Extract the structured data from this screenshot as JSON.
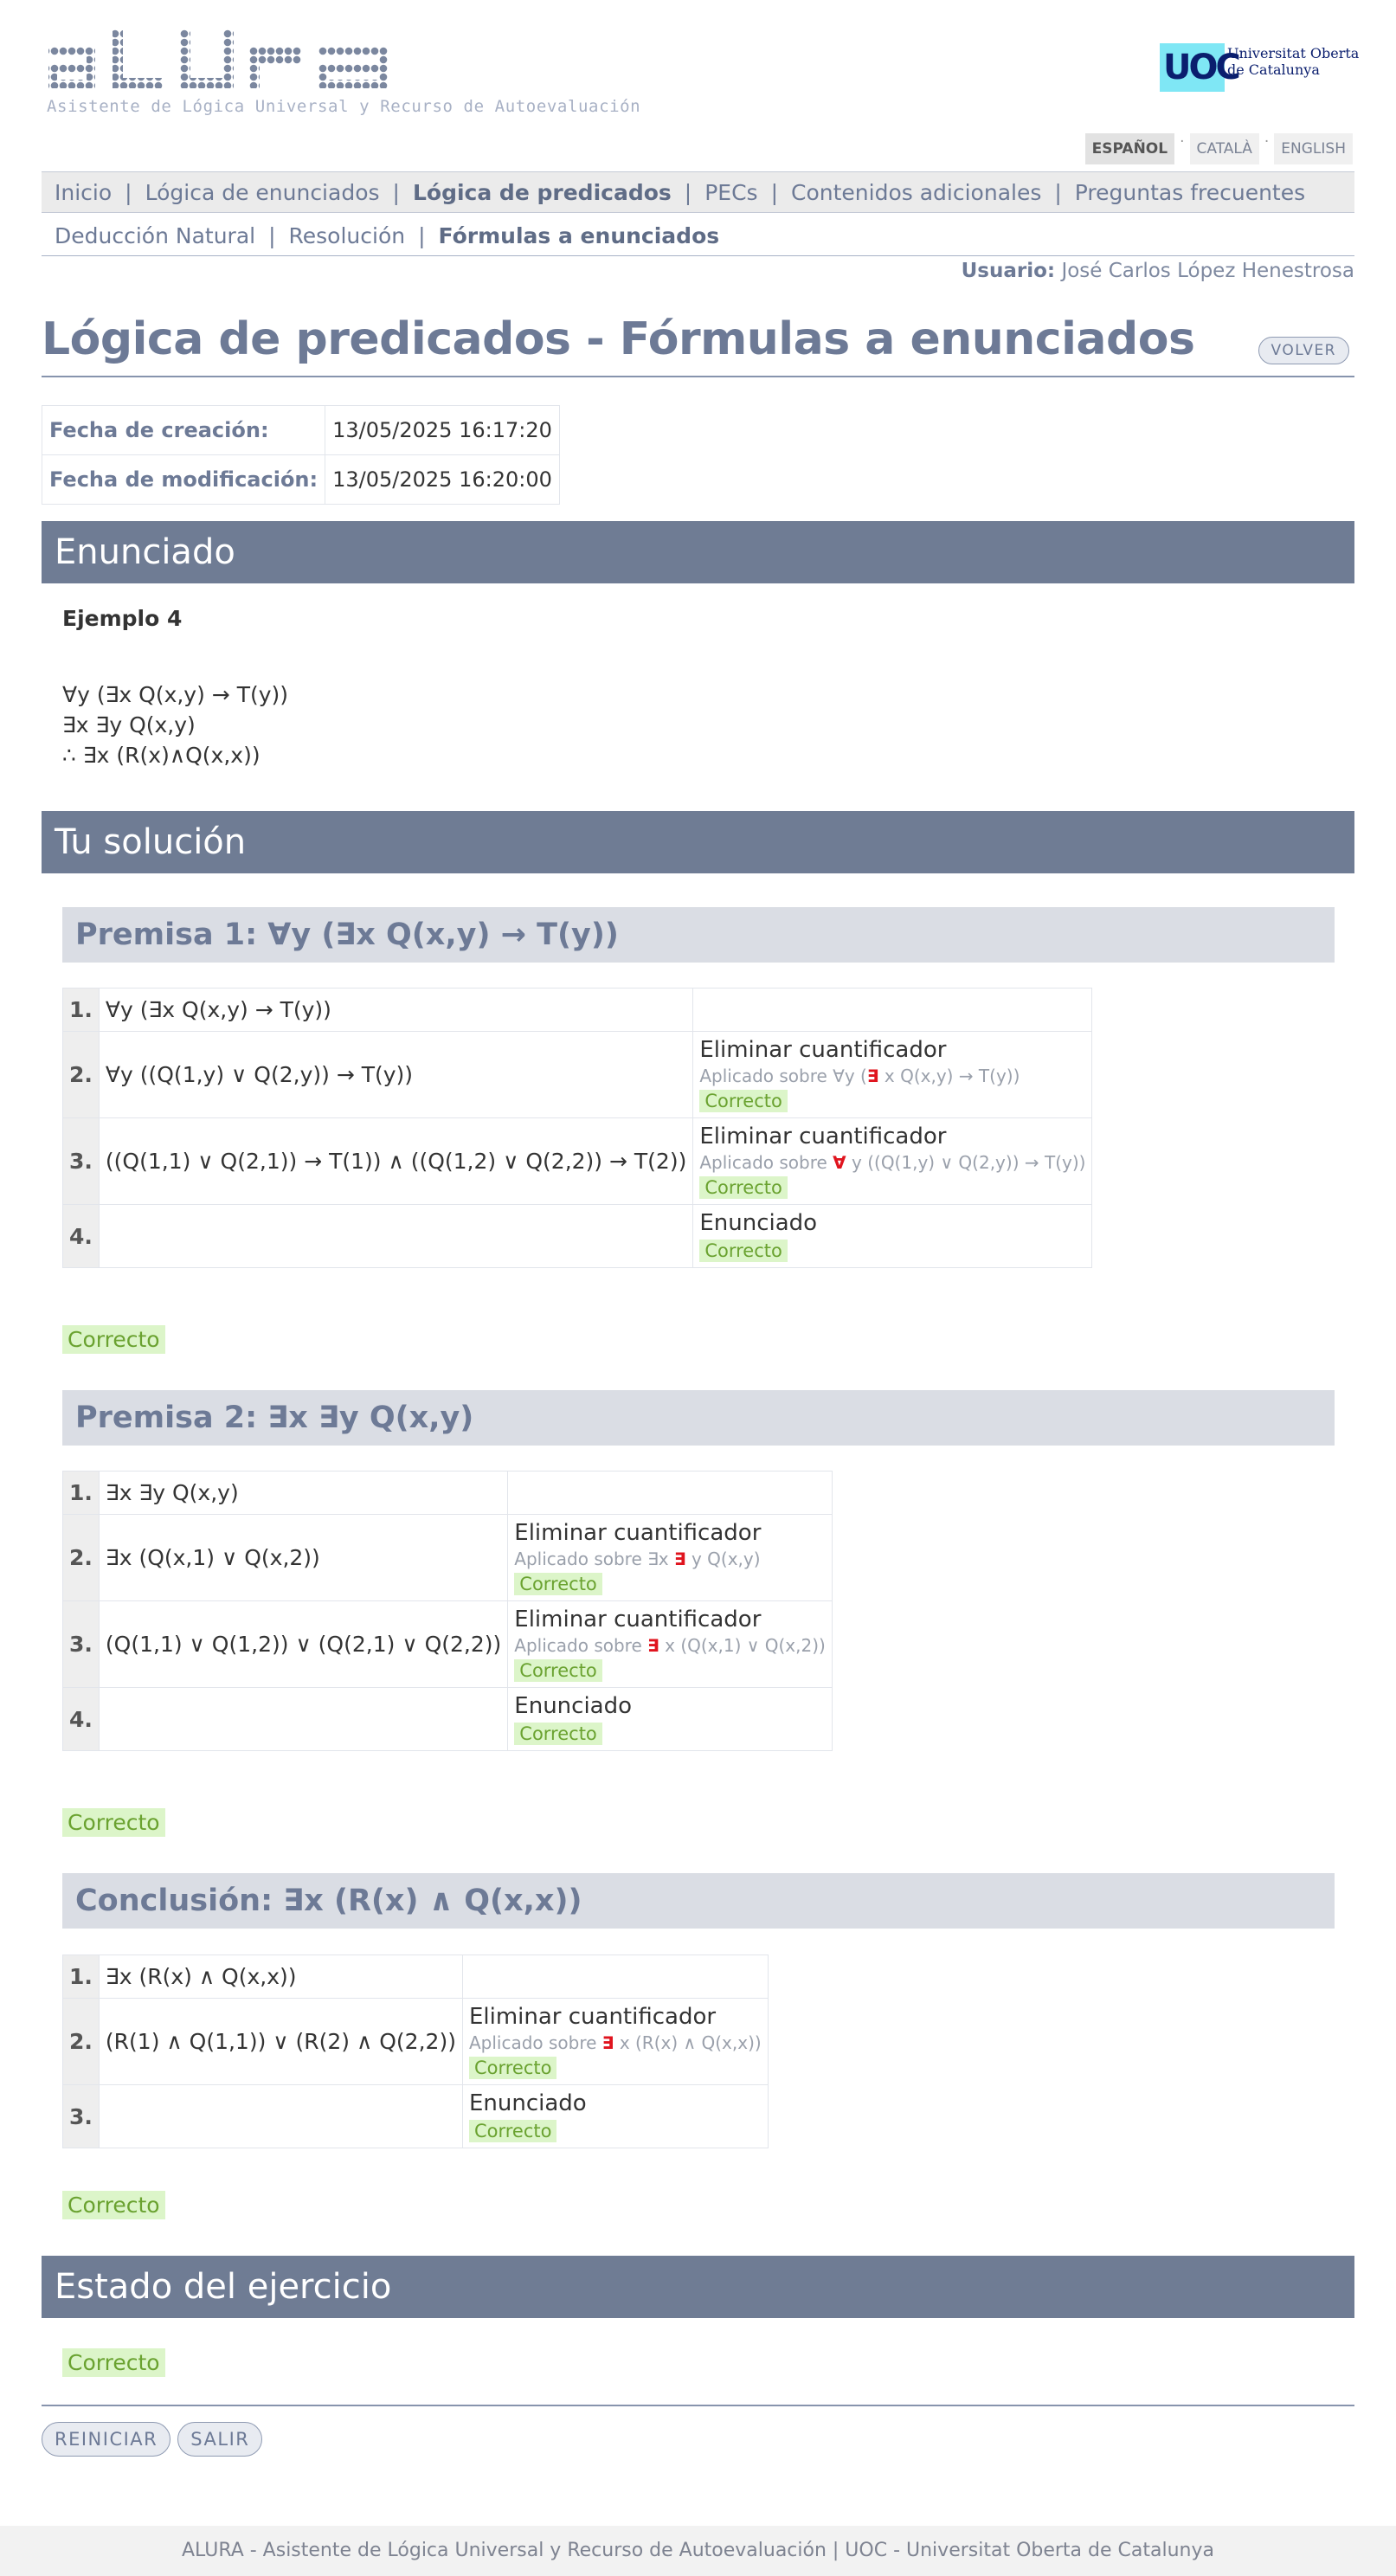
{
  "header": {
    "logo_text": "ALURA",
    "logo_subtitle": "Asistente de Lógica Universal y Recurso de Autoevaluación",
    "uoc_logo": "UOC",
    "uoc_name_line1": "Universitat Oberta",
    "uoc_name_line2": "de Catalunya",
    "languages": [
      "ESPAÑOL",
      "CATALÀ",
      "ENGLISH"
    ],
    "lang_sep": "·"
  },
  "nav": {
    "primary": [
      "Inicio",
      "Lógica de enunciados",
      "Lógica de predicados",
      "PECs",
      "Contenidos adicionales",
      "Preguntas frecuentes"
    ],
    "secondary": [
      "Deducción Natural",
      "Resolución",
      "Fórmulas a enunciados"
    ],
    "sep": "|"
  },
  "user": {
    "label": "Usuario:",
    "name": "José Carlos López Henestrosa"
  },
  "page": {
    "title": "Lógica de predicados - Fórmulas a enunciados",
    "back_button": "VOLVER",
    "created_label": "Fecha de creación:",
    "created_value": "13/05/2025 16:17:20",
    "modified_label": "Fecha de modificación:",
    "modified_value": "13/05/2025 16:20:00"
  },
  "enunciado": {
    "heading": "Enunciado",
    "example": "Ejemplo 4",
    "formulas": [
      "∀y (∃x Q(x,y) → T(y))",
      "∃x ∃y Q(x,y)",
      "∴ ∃x (R(x)∧Q(x,x))"
    ]
  },
  "solucion": {
    "heading": "Tu solución",
    "premisa1": {
      "title": "Premisa 1: ∀y (∃x Q(x,y) → T(y))",
      "rows": [
        {
          "n": "1.",
          "formula": "∀y (∃x Q(x,y) → T(y))",
          "rule": "",
          "applied": "",
          "status": ""
        },
        {
          "n": "2.",
          "formula": "∀y ((Q(1,y) ∨ Q(2,y)) → T(y))",
          "rule": "Eliminar cuantificador",
          "applied_prefix": "Aplicado sobre ∀y (",
          "applied_q": "∃",
          "applied_rest": "x Q(x,y) → T(y))",
          "status": "Correcto"
        },
        {
          "n": "3.",
          "formula": "((Q(1,1) ∨ Q(2,1)) → T(1)) ∧ ((Q(1,2) ∨ Q(2,2)) → T(2))",
          "rule": "Eliminar cuantificador",
          "applied_prefix": "Aplicado sobre ",
          "applied_q": "∀",
          "applied_rest": "y ((Q(1,y) ∨ Q(2,y)) → T(y))",
          "status": "Correcto"
        },
        {
          "n": "4.",
          "formula": "",
          "rule": "Enunciado",
          "status": "Correcto"
        }
      ],
      "result": "Correcto"
    },
    "premisa2": {
      "title": "Premisa 2: ∃x ∃y Q(x,y)",
      "rows": [
        {
          "n": "1.",
          "formula": "∃x ∃y Q(x,y)"
        },
        {
          "n": "2.",
          "formula": "∃x (Q(x,1) ∨ Q(x,2))",
          "rule": "Eliminar cuantificador",
          "applied_prefix": "Aplicado sobre ∃x ",
          "applied_q": "∃",
          "applied_rest": "y Q(x,y)",
          "status": "Correcto"
        },
        {
          "n": "3.",
          "formula": "(Q(1,1) ∨ Q(1,2)) ∨ (Q(2,1) ∨ Q(2,2))",
          "rule": "Eliminar cuantificador",
          "applied_prefix": "Aplicado sobre ",
          "applied_q": "∃",
          "applied_rest": "x (Q(x,1) ∨ Q(x,2))",
          "status": "Correcto"
        },
        {
          "n": "4.",
          "formula": "",
          "rule": "Enunciado",
          "status": "Correcto"
        }
      ],
      "result": "Correcto"
    },
    "conclusion": {
      "title": "Conclusión: ∃x (R(x) ∧ Q(x,x))",
      "rows": [
        {
          "n": "1.",
          "formula": "∃x (R(x) ∧ Q(x,x))"
        },
        {
          "n": "2.",
          "formula": "(R(1) ∧ Q(1,1)) ∨ (R(2) ∧ Q(2,2))",
          "rule": "Eliminar cuantificador",
          "applied_prefix": "Aplicado sobre ",
          "applied_q": "∃",
          "applied_rest": "x (R(x) ∧ Q(x,x))",
          "status": "Correcto"
        },
        {
          "n": "3.",
          "formula": "",
          "rule": "Enunciado",
          "status": "Correcto"
        }
      ],
      "result": "Correcto"
    }
  },
  "estado": {
    "heading": "Estado del ejercicio",
    "status": "Correcto"
  },
  "actions": {
    "restart": "REINICIAR",
    "exit": "SALIR"
  },
  "footer": {
    "text": "ALURA - Asistente de Lógica Universal y Recurso de Autoevaluación | UOC - Universitat Oberta de Catalunya"
  },
  "colors": {
    "accent": "#6f7c94",
    "ok_bg": "#dcf5c9",
    "ok_text": "#6aa230",
    "quantifier_red": "#e0141e"
  }
}
